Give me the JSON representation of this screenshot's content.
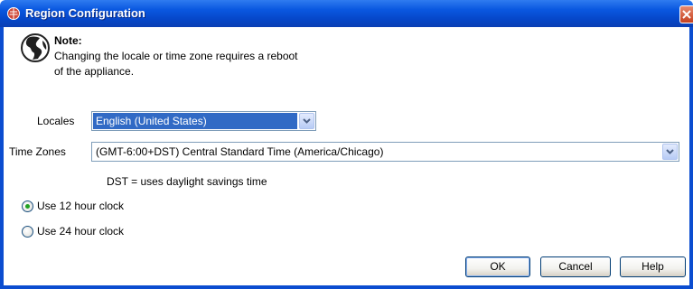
{
  "window": {
    "title": "Region Configuration"
  },
  "note": {
    "title": "Note:",
    "line1": "Changing the locale or time zone requires a reboot",
    "line2": "of the appliance."
  },
  "locales": {
    "label": "Locales",
    "value": "English (United States)"
  },
  "time_zones": {
    "label": "Time Zones",
    "value": "(GMT-6:00+DST) Central Standard Time (America/Chicago)"
  },
  "dst_note": "DST = uses daylight savings time",
  "clock": {
    "option_12": "Use 12 hour clock",
    "option_24": "Use 24 hour clock",
    "selected": "12"
  },
  "buttons": {
    "ok": "OK",
    "cancel": "Cancel",
    "help": "Help"
  },
  "colors": {
    "titlebar": "#0a58e0",
    "selection": "#316ac5",
    "radio_dot": "#21a121"
  }
}
